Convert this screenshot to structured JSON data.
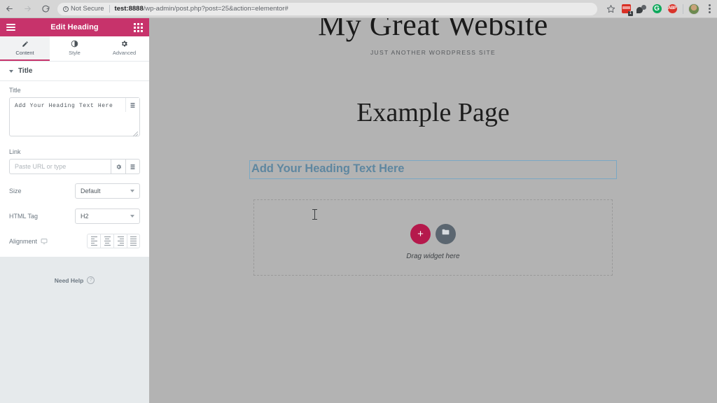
{
  "browser": {
    "back_icon": "back-arrow-icon",
    "forward_icon": "forward-arrow-icon",
    "reload_icon": "reload-icon",
    "security_label": "Not Secure",
    "url_host": "test:8888",
    "url_path": "/wp-admin/post.php?post=25&action=elementor#",
    "url_full": "test:8888/wp-admin/post.php?post=25&action=elementor#",
    "bookmark_icon": "star-icon",
    "extensions": [
      {
        "name": "pdf-extension-icon",
        "badge": "1"
      },
      {
        "name": "dark-reader-extension-icon",
        "badge": ""
      },
      {
        "name": "grammarly-extension-icon",
        "badge": "G"
      },
      {
        "name": "adblock-plus-extension-icon",
        "badge": "ABP"
      }
    ],
    "profile_icon": "avatar",
    "menu_icon": "three-dot-menu-icon"
  },
  "panel": {
    "header": {
      "menu_icon": "hamburger-menu-icon",
      "title": "Edit Heading",
      "apps_icon": "apps-grid-icon",
      "accent_color": "#c7336b"
    },
    "tabs": [
      {
        "label": "Content",
        "icon": "pencil-icon",
        "active": true
      },
      {
        "label": "Style",
        "icon": "contrast-icon",
        "active": false
      },
      {
        "label": "Advanced",
        "icon": "gear-icon",
        "active": false
      }
    ],
    "section": {
      "title": "Title",
      "collapse_icon": "chevron-down-icon"
    },
    "controls": {
      "title_label": "Title",
      "title_value": "Add Your Heading Text Here",
      "title_dynamic_icon": "dynamic-tags-icon",
      "link_label": "Link",
      "link_value": "",
      "link_placeholder": "Paste URL or type",
      "link_options_icon": "gear-icon",
      "link_dynamic_icon": "dynamic-tags-icon",
      "size_label": "Size",
      "size_value": "Default",
      "html_tag_label": "HTML Tag",
      "html_tag_value": "H2",
      "alignment_label": "Alignment",
      "alignment_responsive_icon": "desktop-icon",
      "alignment_options": [
        "align-left",
        "align-center",
        "align-right",
        "align-justify"
      ]
    },
    "footer": {
      "need_help_label": "Need Help",
      "need_help_icon": "question-circle-icon"
    },
    "collapse_handle_icon": "chevron-left-icon"
  },
  "preview": {
    "site_title": "My Great Website",
    "site_tagline": "JUST ANOTHER WORDPRESS SITE",
    "page_title": "Example Page",
    "heading_widget_text": "Add Your Heading Text Here",
    "heading_widget_color": "#5f87a0",
    "drop_zone": {
      "add_section_icon": "plus-icon",
      "template_library_icon": "folder-icon",
      "label": "Drag widget here",
      "add_button_color": "#b5194c"
    },
    "cursor_icon": "text-cursor-icon",
    "background_color": "#b3b3b3"
  }
}
